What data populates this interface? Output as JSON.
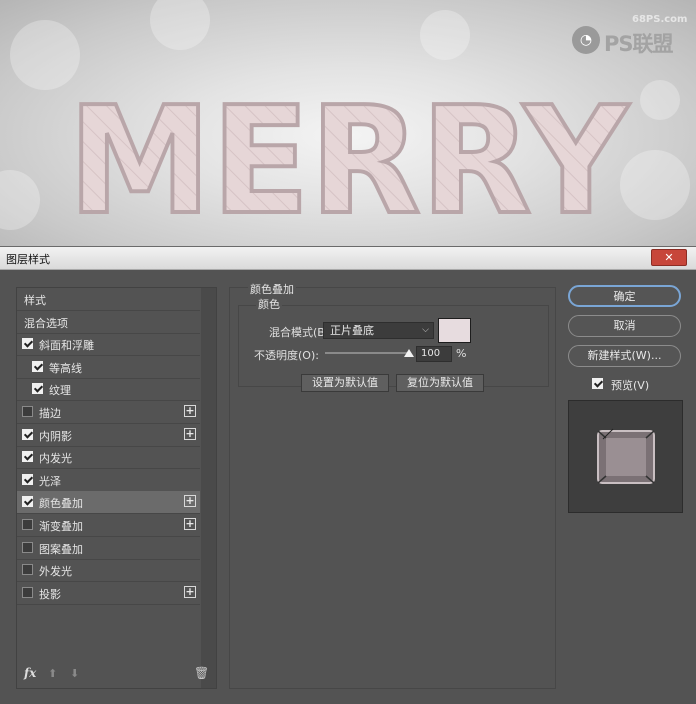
{
  "artwork": {
    "title_text": "MERRY",
    "watermark_small": "68PS.com",
    "watermark_brand": "PS联盟"
  },
  "dialog": {
    "title": "图层样式",
    "close_label": "✕"
  },
  "style_list": {
    "items": [
      {
        "label": "样式",
        "checkbox": false,
        "checked": false,
        "plus": false,
        "indent": false
      },
      {
        "label": "混合选项",
        "checkbox": false,
        "checked": false,
        "plus": false,
        "indent": false
      },
      {
        "label": "斜面和浮雕",
        "checkbox": true,
        "checked": true,
        "plus": false,
        "indent": false
      },
      {
        "label": "等高线",
        "checkbox": true,
        "checked": true,
        "plus": false,
        "indent": true
      },
      {
        "label": "纹理",
        "checkbox": true,
        "checked": true,
        "plus": false,
        "indent": true
      },
      {
        "label": "描边",
        "checkbox": true,
        "checked": false,
        "plus": true,
        "indent": false
      },
      {
        "label": "内阴影",
        "checkbox": true,
        "checked": true,
        "plus": true,
        "indent": false
      },
      {
        "label": "内发光",
        "checkbox": true,
        "checked": true,
        "plus": false,
        "indent": false
      },
      {
        "label": "光泽",
        "checkbox": true,
        "checked": true,
        "plus": false,
        "indent": false
      },
      {
        "label": "颜色叠加",
        "checkbox": true,
        "checked": true,
        "plus": true,
        "indent": false,
        "selected": true
      },
      {
        "label": "渐变叠加",
        "checkbox": true,
        "checked": false,
        "plus": true,
        "indent": false
      },
      {
        "label": "图案叠加",
        "checkbox": true,
        "checked": false,
        "plus": false,
        "indent": false
      },
      {
        "label": "外发光",
        "checkbox": true,
        "checked": false,
        "plus": false,
        "indent": false
      },
      {
        "label": "投影",
        "checkbox": true,
        "checked": false,
        "plus": true,
        "indent": false
      }
    ],
    "fx_label": "fx"
  },
  "color_overlay": {
    "section_title": "颜色叠加",
    "group_title": "颜色",
    "blend_mode_label": "混合模式(B):",
    "blend_mode_value": "正片叠底",
    "overlay_color": "#e7dcdf",
    "opacity_label": "不透明度(O):",
    "opacity_value": "100",
    "opacity_unit": "%",
    "set_default_label": "设置为默认值",
    "reset_default_label": "复位为默认值"
  },
  "actions": {
    "ok_label": "确定",
    "cancel_label": "取消",
    "new_style_label": "新建样式(W)...",
    "preview_label": "预览(V)",
    "preview_checked": true
  }
}
